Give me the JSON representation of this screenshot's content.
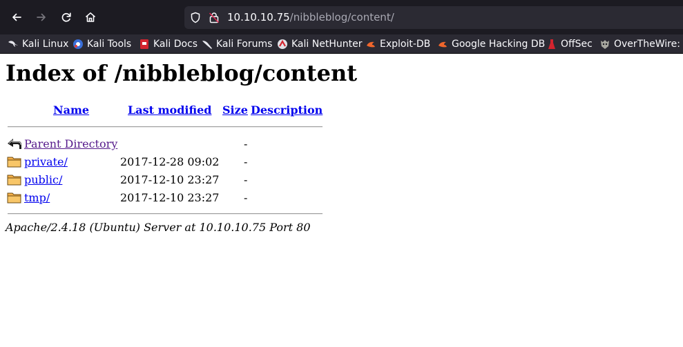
{
  "browser": {
    "url_host": "10.10.10.75",
    "url_path": "/nibbleblog/content/",
    "bookmarks": [
      {
        "label": "Kali Linux",
        "icon": "kali-linux-icon"
      },
      {
        "label": "Kali Tools",
        "icon": "kali-tools-icon"
      },
      {
        "label": "Kali Docs",
        "icon": "kali-docs-icon"
      },
      {
        "label": "Kali Forums",
        "icon": "kali-forums-icon"
      },
      {
        "label": "Kali NetHunter",
        "icon": "kali-nethunter-icon"
      },
      {
        "label": "Exploit-DB",
        "icon": "exploit-db-icon"
      },
      {
        "label": "Google Hacking DB",
        "icon": "google-hacking-db-icon"
      },
      {
        "label": "OffSec",
        "icon": "offsec-icon"
      },
      {
        "label": "OverTheWire: W",
        "icon": "overthewire-icon"
      }
    ]
  },
  "page": {
    "title": "Index of /nibbleblog/content",
    "columns": {
      "name": "Name",
      "modified": "Last modified",
      "size": "Size",
      "description": "Description"
    },
    "rows": [
      {
        "name": "Parent Directory",
        "modified": "",
        "size": "-",
        "icon": "back-arrow-icon",
        "visited": true
      },
      {
        "name": "private/",
        "modified": "2017-12-28 09:02",
        "size": "-",
        "icon": "folder-icon",
        "visited": false
      },
      {
        "name": "public/",
        "modified": "2017-12-10 23:27",
        "size": "-",
        "icon": "folder-icon",
        "visited": false
      },
      {
        "name": "tmp/",
        "modified": "2017-12-10 23:27",
        "size": "-",
        "icon": "folder-icon",
        "visited": false
      }
    ],
    "footer": "Apache/2.4.18 (Ubuntu) Server at 10.10.10.75 Port 80"
  },
  "colors": {
    "link": "#0000ee",
    "visited": "#551a8b",
    "toolbar": "#1c1b22",
    "bookmarks_bar": "#2b2a33"
  }
}
